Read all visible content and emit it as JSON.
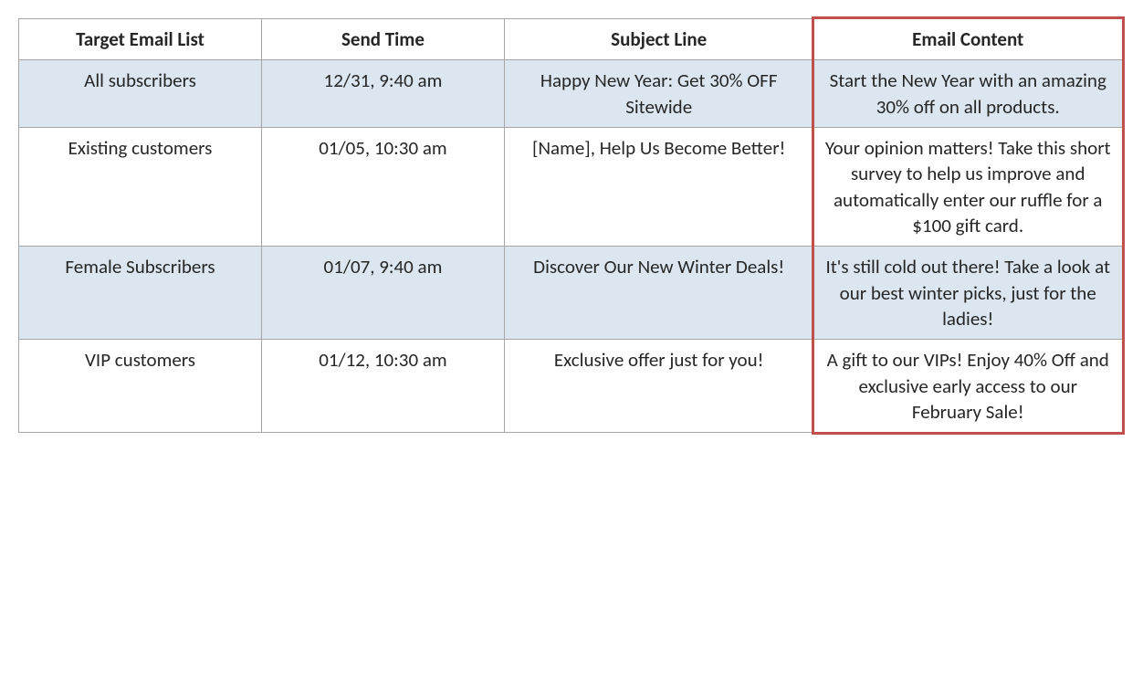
{
  "table": {
    "headers": [
      "Target Email List",
      "Send Time",
      "Subject Line",
      "Email Content"
    ],
    "rows": [
      {
        "target": "All subscribers",
        "send_time": "12/31, 9:40 am",
        "subject": "Happy New Year: Get 30% OFF Sitewide",
        "content": "Start the New Year with an amazing 30% off on all products."
      },
      {
        "target": "Existing customers",
        "send_time": "01/05, 10:30 am",
        "subject": "[Name], Help Us Become Better!",
        "content": "Your opinion matters! Take this short survey to help us improve and automatically enter our ruffle for a $100 gift card."
      },
      {
        "target": "Female Subscribers",
        "send_time": "01/07, 9:40 am",
        "subject": "Discover Our New Winter Deals!",
        "content": "It's still cold out there! Take a look at our best winter picks, just for the ladies!"
      },
      {
        "target": "VIP customers",
        "send_time": "01/12, 10:30 am",
        "subject": "Exclusive offer just for you!",
        "content": "A gift to our VIPs! Enjoy 40% Off and exclusive early access to our February Sale!"
      }
    ]
  },
  "highlight": {
    "column_index": 3
  }
}
